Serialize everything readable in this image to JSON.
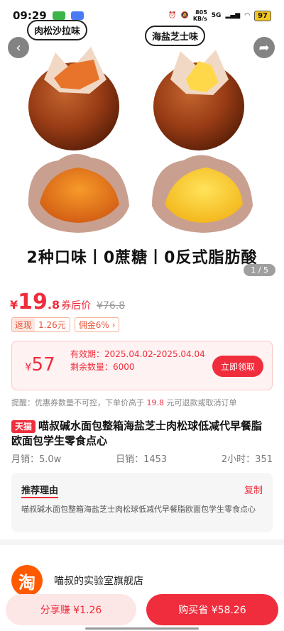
{
  "status": {
    "time": "09:29",
    "net_speed_value": "805",
    "net_speed_unit": "KB/s",
    "signal_label": "5G",
    "battery": "97",
    "app_colors": [
      "#3bb54a",
      "#4a7bf7"
    ]
  },
  "hero": {
    "flavor_left": "肉松沙拉味",
    "flavor_right": "海盐芝士味",
    "caption": "2种口味丨0蔗糖丨0反式脂肪酸",
    "counter": "1 / 5",
    "icons": {
      "back": "chevron-left-icon",
      "share": "share-icon"
    }
  },
  "price": {
    "currency": "¥",
    "int": "19",
    "dec": ".8",
    "after_coupon_label": "券后价",
    "original": "¥76.8",
    "rebate_label": "返现",
    "rebate_value": "1.26元",
    "commission": "佣金6%",
    "accent_color": "#ef2d3c"
  },
  "coupon": {
    "currency": "¥",
    "amount": "57",
    "validity_label": "有效期：",
    "validity": "2025.04.02-2025.04.04",
    "remaining_label": "剩余数量：",
    "remaining": "6000",
    "button": "立即领取"
  },
  "notice": {
    "text_before": "提醒：优惠券数量不可控，下单价高于 ",
    "highlight": "19.8",
    "text_after": " 元可退款或取消订单"
  },
  "product": {
    "platform_badge": "天猫",
    "title": "喵叔碱水面包整箱海盐芝士肉松球低减代早餐脂欧面包学生零食点心"
  },
  "stats": {
    "monthly": "月销：5.0w",
    "daily": "日销：1453",
    "two_hours": "2小时：351"
  },
  "reason": {
    "title": "推荐理由",
    "copy": "复制",
    "text": "喵叔碱水面包整箱海盐芝士肉松球低减代早餐脂欧面包学生零食点心"
  },
  "shop": {
    "logo": "淘",
    "name": "喵叔的实验室旗舰店"
  },
  "actions": {
    "share": "分享赚 ¥1.26",
    "buy": "购买省 ¥58.26"
  }
}
